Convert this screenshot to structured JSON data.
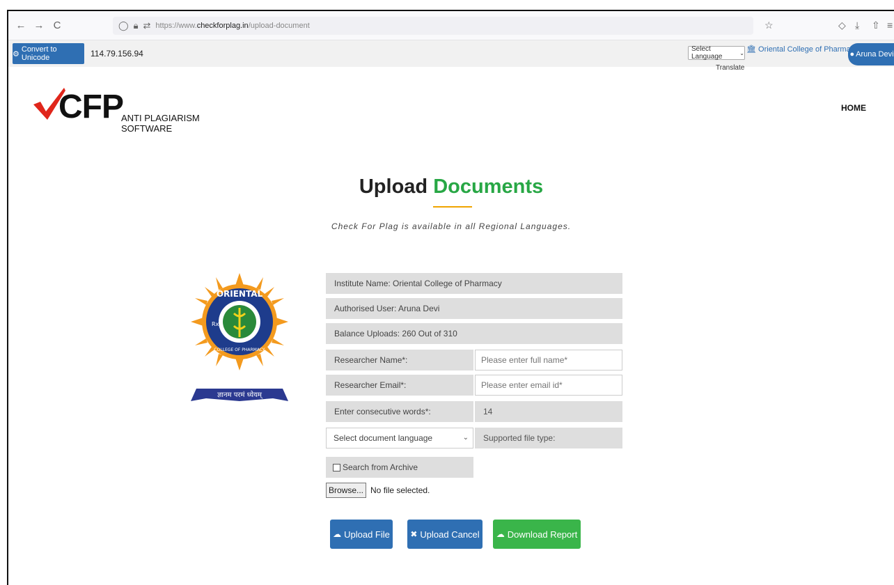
{
  "browser": {
    "url_prefix": "https://www.",
    "url_host": "checkforplag.in",
    "url_path": "/upload-document"
  },
  "site_bar": {
    "convert_label": "Convert to Unicode",
    "ip": "114.79.156.94",
    "language_select": "Select Language",
    "translate": "Translate",
    "college": "Oriental College of Pharmacy",
    "user": "Aruna Devi"
  },
  "header": {
    "logo_text": "CFP",
    "tagline": "ANTI PLAGIARISM SOFTWARE",
    "home": "HOME"
  },
  "page": {
    "title_part1": "Upload ",
    "title_part2": "Documents",
    "subtitle": "Check For Plag is available in all Regional Languages."
  },
  "emblem": {
    "top_text": "ORIENTAL",
    "bottom_text": "COLLEGE OF PHARMACY",
    "rx": "Rx",
    "banner": "ज्ञानम परमं ध्येयम्"
  },
  "form": {
    "institute": "Institute Name: Oriental College of Pharmacy",
    "user": "Authorised User: Aruna Devi",
    "balance": "Balance Uploads: 260 Out of 310",
    "researcher_name_label": "Researcher Name*:",
    "researcher_name_placeholder": "Please enter full name*",
    "researcher_email_label": "Researcher Email*:",
    "researcher_email_placeholder": "Please enter email id*",
    "consecutive_label": "Enter consecutive words*:",
    "consecutive_value": "14",
    "language_select": "Select document language",
    "supported_label": "Supported file type:",
    "archive_label": "Search from Archive",
    "browse_label": "Browse...",
    "no_file": "No file selected."
  },
  "buttons": {
    "upload": "Upload File",
    "cancel": "Upload Cancel",
    "report": "Download Report"
  },
  "colors": {
    "primary": "#2f6fb3",
    "green": "#28a745",
    "accent": "#f0a400"
  }
}
